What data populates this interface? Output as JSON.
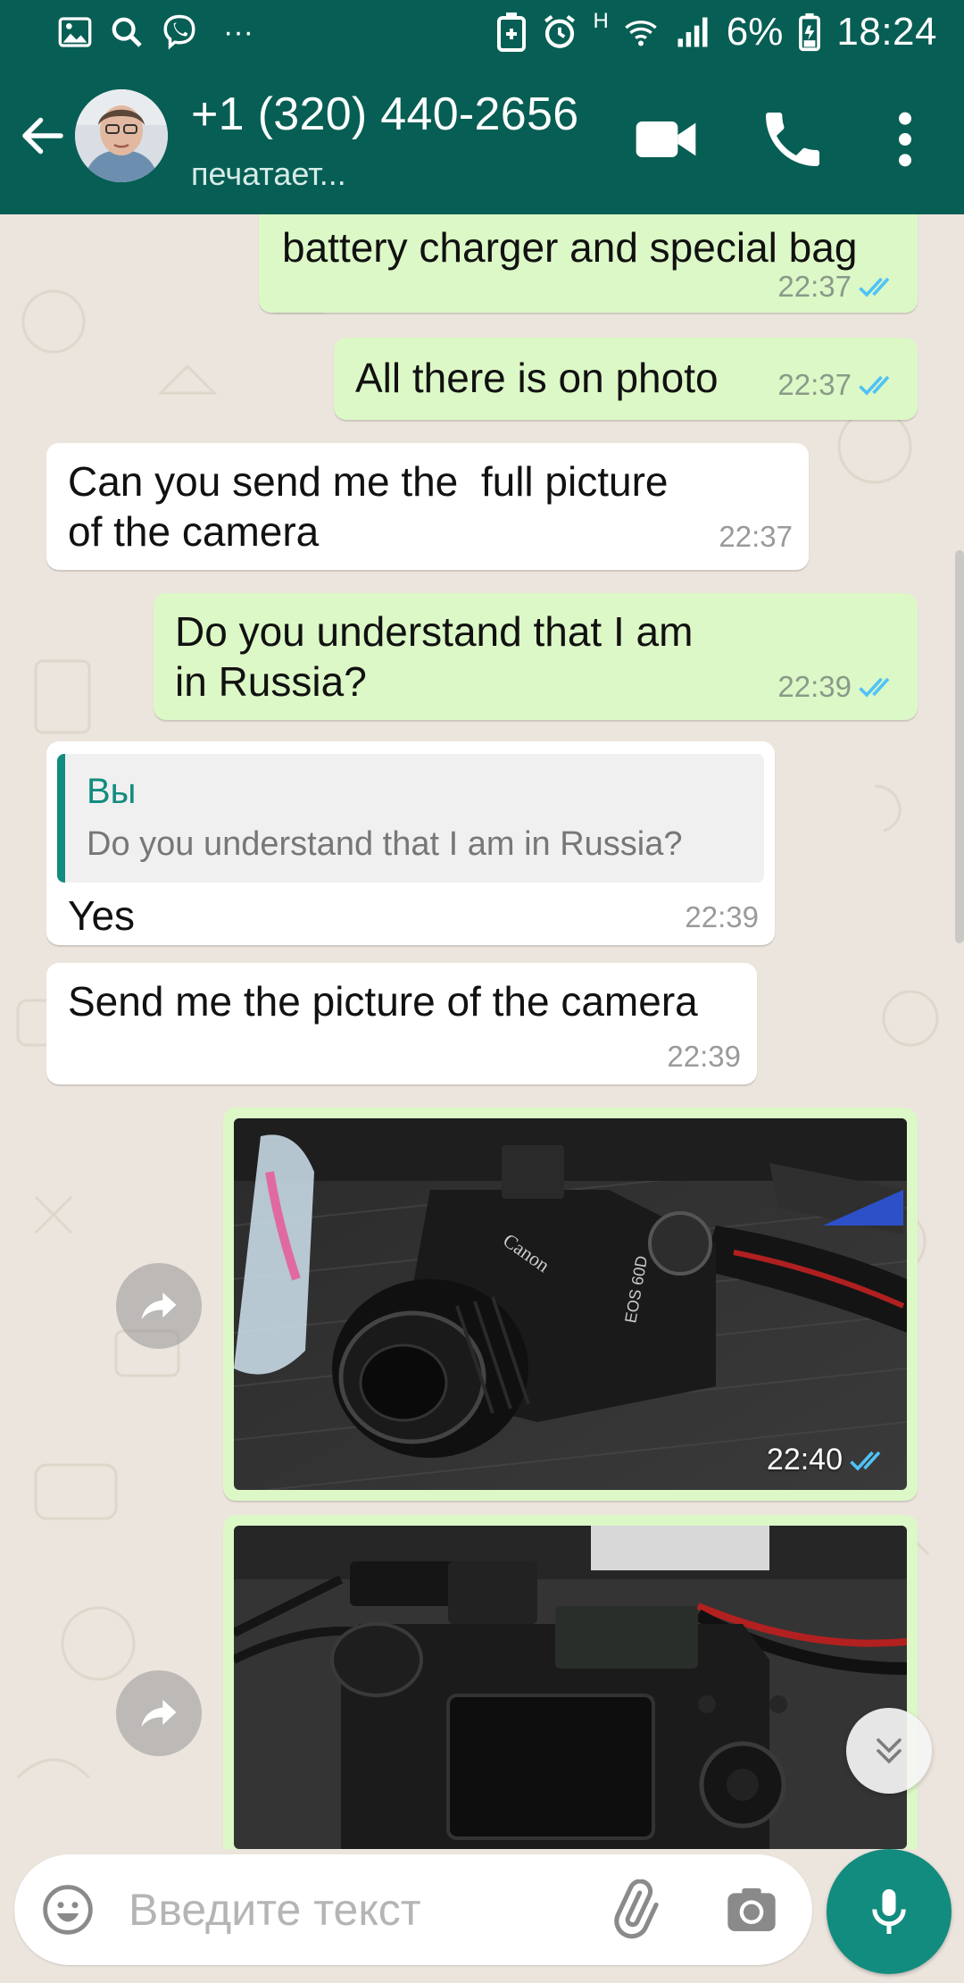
{
  "status_bar": {
    "battery_percent": "6%",
    "time": "18:24",
    "network": "H",
    "overflow": "···"
  },
  "header": {
    "contact_name": "+1 (320) 440-2656",
    "contact_status": "печатает..."
  },
  "messages": [
    {
      "direction": "outgoing",
      "text": "battery charger and special bag",
      "time": "22:37",
      "read": true
    },
    {
      "direction": "outgoing",
      "text": "All there is on photo",
      "time": "22:37",
      "read": true
    },
    {
      "direction": "incoming",
      "text_line1": "Can you send me the  full picture",
      "text_line2": "of the camera",
      "time": "22:37"
    },
    {
      "direction": "outgoing",
      "text_line1": "Do you understand that I am",
      "text_line2": "in Russia?",
      "time": "22:39",
      "read": true
    },
    {
      "direction": "incoming",
      "quote_author": "Вы",
      "quote_text": "Do you understand that I am in Russia?",
      "text": "Yes",
      "time": "22:39"
    },
    {
      "direction": "incoming",
      "text": "Send me the picture of the camera",
      "time": "22:39"
    },
    {
      "direction": "outgoing",
      "type": "image",
      "photo_label": "Canon EOS 60D",
      "time": "22:40",
      "read": true
    },
    {
      "direction": "outgoing",
      "type": "image",
      "photo_label": "Canon EOS 60D rear",
      "time": "",
      "read": false
    }
  ],
  "input": {
    "placeholder": "Введите текст"
  },
  "icons": {
    "back": "arrow-left-icon",
    "video": "video-camera-icon",
    "call": "phone-icon",
    "menu": "more-vertical-icon",
    "emoji": "emoji-icon",
    "attach": "paperclip-icon",
    "camera": "camera-icon",
    "mic": "microphone-icon",
    "forward": "forward-icon",
    "scroll": "double-chevron-down-icon"
  },
  "colors": {
    "brand_dark": "#075e54",
    "brand_teal": "#128c7e",
    "outgoing_bubble": "#dcf8c6",
    "incoming_bubble": "#ffffff",
    "read_tick": "#4fc3f7",
    "chat_background": "#ece5dd"
  }
}
